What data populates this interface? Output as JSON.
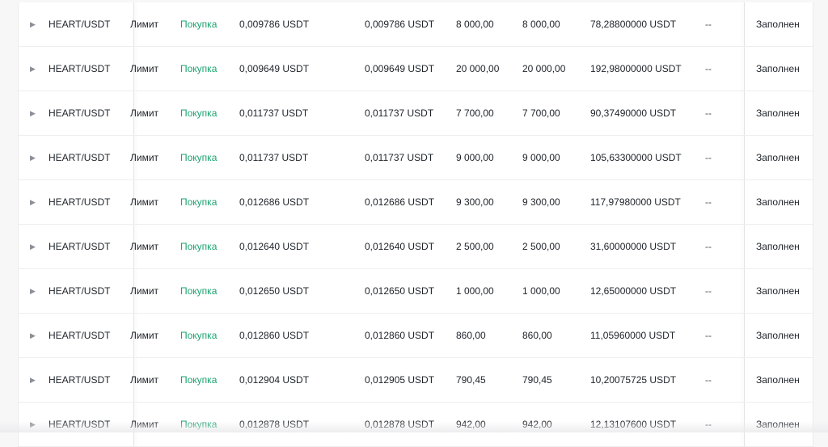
{
  "colors": {
    "buy": "#1aa36f",
    "text": "#1e2329",
    "muted": "#8a8f98"
  },
  "expand_icon": "triangle-right-icon",
  "orders": [
    {
      "pair": "HEART/USDT",
      "type": "Лимит",
      "side": "Покупка",
      "price": "0,009786 USDT",
      "avg_price": "0,009786 USDT",
      "amount": "8 000,00",
      "filled": "8 000,00",
      "total": "78,28800000 USDT",
      "trigger": "--",
      "status": "Заполнен"
    },
    {
      "pair": "HEART/USDT",
      "type": "Лимит",
      "side": "Покупка",
      "price": "0,009649 USDT",
      "avg_price": "0,009649 USDT",
      "amount": "20 000,00",
      "filled": "20 000,00",
      "total": "192,98000000 USDT",
      "trigger": "--",
      "status": "Заполнен"
    },
    {
      "pair": "HEART/USDT",
      "type": "Лимит",
      "side": "Покупка",
      "price": "0,011737 USDT",
      "avg_price": "0,011737 USDT",
      "amount": "7 700,00",
      "filled": "7 700,00",
      "total": "90,37490000 USDT",
      "trigger": "--",
      "status": "Заполнен"
    },
    {
      "pair": "HEART/USDT",
      "type": "Лимит",
      "side": "Покупка",
      "price": "0,011737 USDT",
      "avg_price": "0,011737 USDT",
      "amount": "9 000,00",
      "filled": "9 000,00",
      "total": "105,63300000 USDT",
      "trigger": "--",
      "status": "Заполнен"
    },
    {
      "pair": "HEART/USDT",
      "type": "Лимит",
      "side": "Покупка",
      "price": "0,012686 USDT",
      "avg_price": "0,012686 USDT",
      "amount": "9 300,00",
      "filled": "9 300,00",
      "total": "117,97980000 USDT",
      "trigger": "--",
      "status": "Заполнен"
    },
    {
      "pair": "HEART/USDT",
      "type": "Лимит",
      "side": "Покупка",
      "price": "0,012640 USDT",
      "avg_price": "0,012640 USDT",
      "amount": "2 500,00",
      "filled": "2 500,00",
      "total": "31,60000000 USDT",
      "trigger": "--",
      "status": "Заполнен"
    },
    {
      "pair": "HEART/USDT",
      "type": "Лимит",
      "side": "Покупка",
      "price": "0,012650 USDT",
      "avg_price": "0,012650 USDT",
      "amount": "1 000,00",
      "filled": "1 000,00",
      "total": "12,65000000 USDT",
      "trigger": "--",
      "status": "Заполнен"
    },
    {
      "pair": "HEART/USDT",
      "type": "Лимит",
      "side": "Покупка",
      "price": "0,012860 USDT",
      "avg_price": "0,012860 USDT",
      "amount": "860,00",
      "filled": "860,00",
      "total": "11,05960000 USDT",
      "trigger": "--",
      "status": "Заполнен"
    },
    {
      "pair": "HEART/USDT",
      "type": "Лимит",
      "side": "Покупка",
      "price": "0,012904 USDT",
      "avg_price": "0,012905 USDT",
      "amount": "790,45",
      "filled": "790,45",
      "total": "10,20075725 USDT",
      "trigger": "--",
      "status": "Заполнен"
    },
    {
      "pair": "HEART/USDT",
      "type": "Лимит",
      "side": "Покупка",
      "price": "0,012878 USDT",
      "avg_price": "0,012878 USDT",
      "amount": "942,00",
      "filled": "942,00",
      "total": "12,13107600 USDT",
      "trigger": "--",
      "status": "Заполнен"
    }
  ]
}
